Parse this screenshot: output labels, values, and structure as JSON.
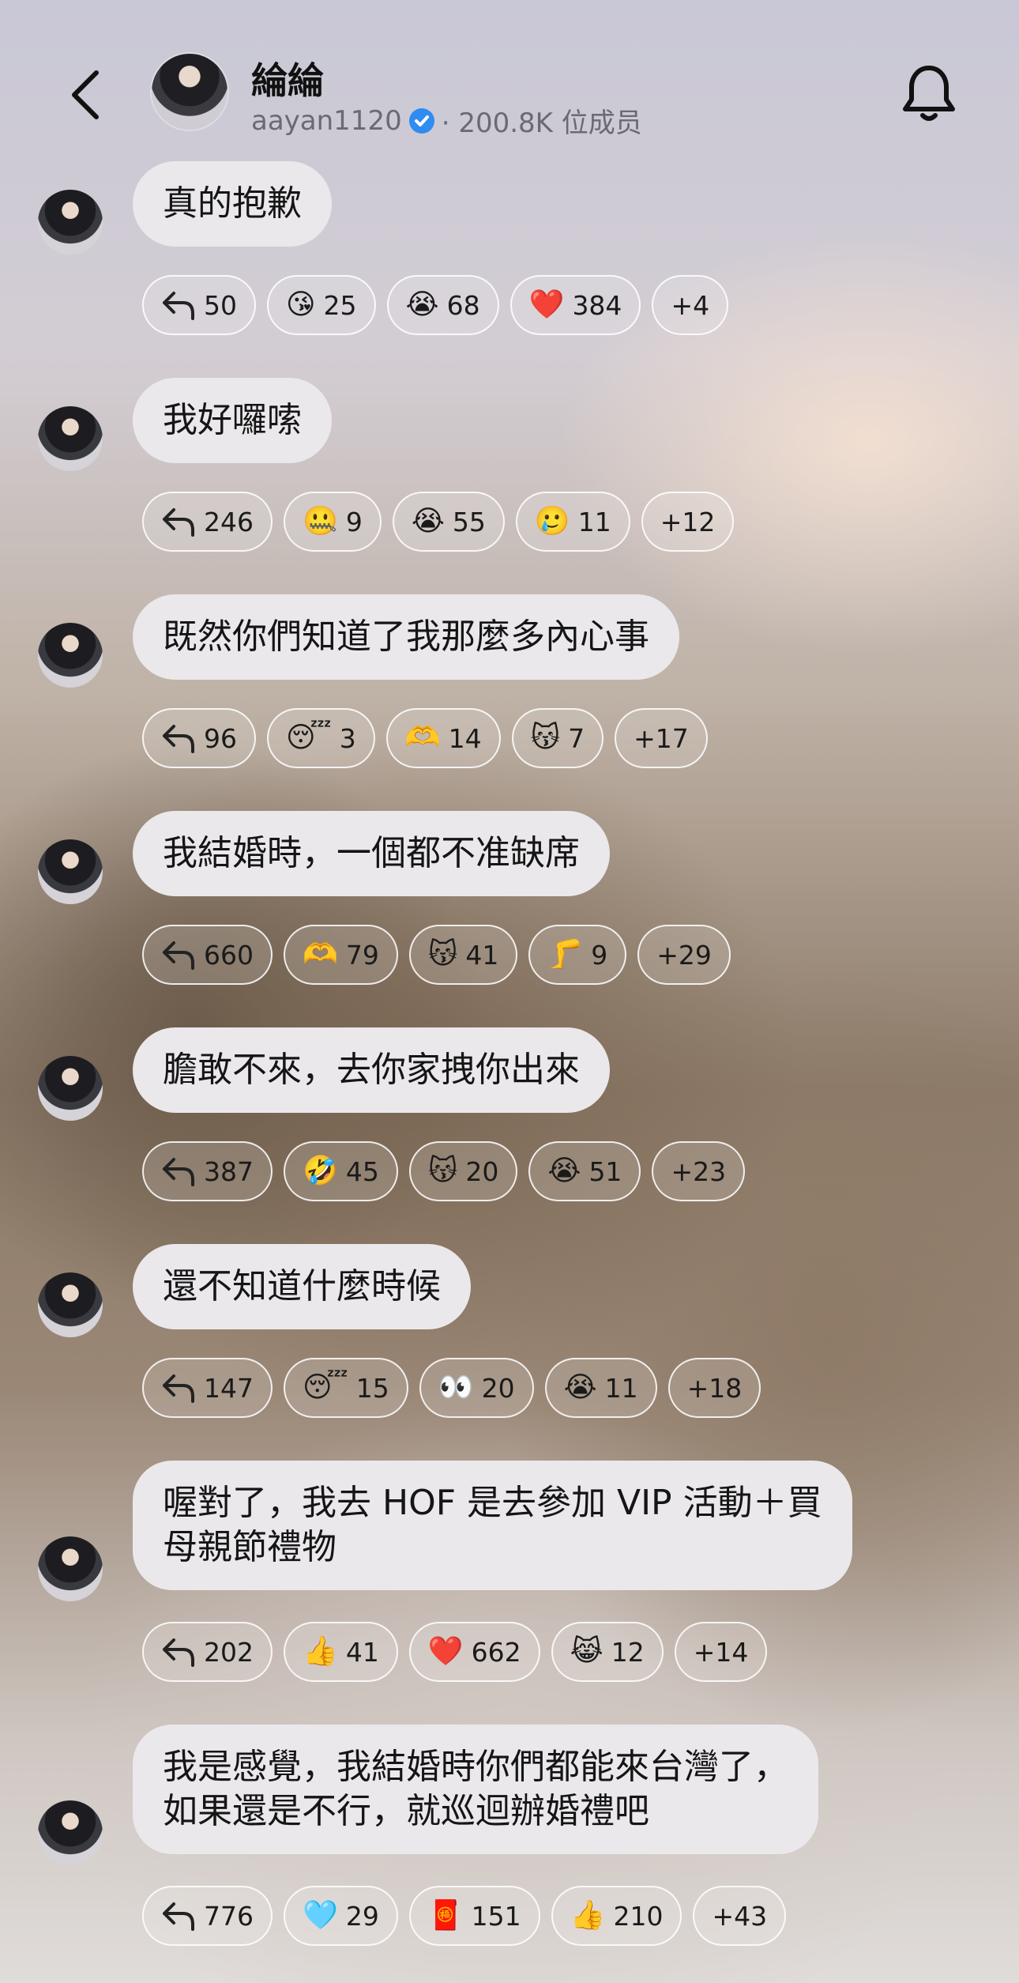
{
  "header": {
    "title": "綸綸",
    "username": "aayan1120",
    "members": "· 200.8K 位成员"
  },
  "messages": [
    {
      "text": "真的抱歉",
      "reply_count": "50",
      "reactions": [
        {
          "emoji": "😘",
          "count": "25"
        },
        {
          "emoji": "😭",
          "count": "68"
        },
        {
          "emoji": "❤️",
          "count": "384"
        }
      ],
      "more": "+4"
    },
    {
      "text": "我好囉嗦",
      "reply_count": "246",
      "reactions": [
        {
          "emoji": "🤐",
          "count": "9"
        },
        {
          "emoji": "😭",
          "count": "55"
        },
        {
          "emoji": "🥲",
          "count": "11"
        }
      ],
      "more": "+12"
    },
    {
      "text": "既然你們知道了我那麼多內心事",
      "reply_count": "96",
      "reactions": [
        {
          "emoji": "😴",
          "count": "3"
        },
        {
          "emoji": "🫶",
          "count": "14"
        },
        {
          "emoji": "😽",
          "count": "7"
        }
      ],
      "more": "+17"
    },
    {
      "text": "我結婚時，一個都不准缺席",
      "reply_count": "660",
      "reactions": [
        {
          "emoji": "🫶",
          "count": "79"
        },
        {
          "emoji": "😽",
          "count": "41"
        },
        {
          "emoji": "🦵",
          "count": "9"
        }
      ],
      "more": "+29"
    },
    {
      "text": "膽敢不來，去你家拽你出來",
      "reply_count": "387",
      "reactions": [
        {
          "emoji": "🤣",
          "count": "45"
        },
        {
          "emoji": "😽",
          "count": "20"
        },
        {
          "emoji": "😭",
          "count": "51"
        }
      ],
      "more": "+23"
    },
    {
      "text": "還不知道什麼時候",
      "reply_count": "147",
      "reactions": [
        {
          "emoji": "😴",
          "count": "15"
        },
        {
          "emoji": "👀",
          "count": "20"
        },
        {
          "emoji": "😭",
          "count": "11"
        }
      ],
      "more": "+18"
    },
    {
      "text": "喔對了，我去 HOF 是去參加 VIP 活動＋買\n母親節禮物",
      "reply_count": "202",
      "reactions": [
        {
          "emoji": "👍",
          "count": "41"
        },
        {
          "emoji": "❤️",
          "count": "662"
        },
        {
          "emoji": "😹",
          "count": "12"
        }
      ],
      "more": "+14"
    },
    {
      "text": "我是感覺，我結婚時你們都能來台灣了，\n如果還是不行，就巡迴辦婚禮吧",
      "reply_count": "776",
      "reactions": [
        {
          "emoji": "🩵",
          "count": "29"
        },
        {
          "emoji": "🧧",
          "count": "151"
        },
        {
          "emoji": "👍",
          "count": "210"
        }
      ],
      "more": "+43"
    }
  ]
}
